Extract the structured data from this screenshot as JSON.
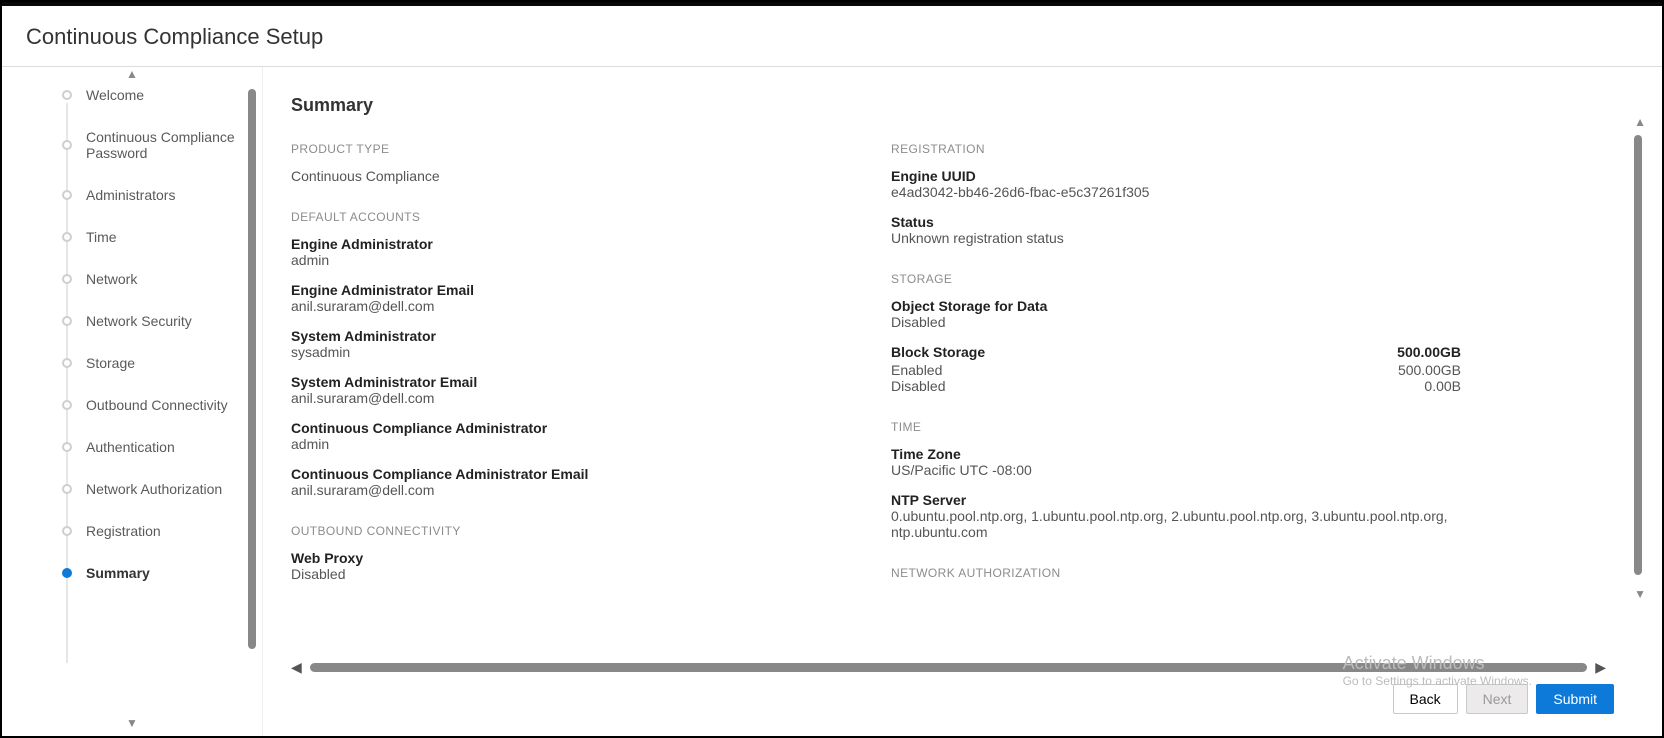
{
  "header": {
    "title": "Continuous Compliance Setup"
  },
  "sidebar": {
    "steps": [
      {
        "label": "Welcome"
      },
      {
        "label": "Continuous Compliance Password"
      },
      {
        "label": "Administrators"
      },
      {
        "label": "Time"
      },
      {
        "label": "Network"
      },
      {
        "label": "Network Security"
      },
      {
        "label": "Storage"
      },
      {
        "label": "Outbound Connectivity"
      },
      {
        "label": "Authentication"
      },
      {
        "label": "Network Authorization"
      },
      {
        "label": "Registration"
      },
      {
        "label": "Summary"
      }
    ],
    "active_index": 11
  },
  "main": {
    "title": "Summary",
    "left": {
      "product_type": {
        "heading": "PRODUCT TYPE",
        "value": "Continuous Compliance"
      },
      "default_accounts": {
        "heading": "DEFAULT ACCOUNTS",
        "engine_admin": {
          "label": "Engine Administrator",
          "value": "admin"
        },
        "engine_admin_email": {
          "label": "Engine Administrator Email",
          "value": "anil.suraram@dell.com"
        },
        "sys_admin": {
          "label": "System Administrator",
          "value": "sysadmin"
        },
        "sys_admin_email": {
          "label": "System Administrator Email",
          "value": "anil.suraram@dell.com"
        },
        "cc_admin": {
          "label": "Continuous Compliance Administrator",
          "value": "admin"
        },
        "cc_admin_email": {
          "label": "Continuous Compliance Administrator Email",
          "value": "anil.suraram@dell.com"
        }
      },
      "outbound": {
        "heading": "OUTBOUND CONNECTIVITY",
        "web_proxy": {
          "label": "Web Proxy",
          "value": "Disabled"
        }
      }
    },
    "right": {
      "registration": {
        "heading": "REGISTRATION",
        "uuid": {
          "label": "Engine UUID",
          "value": "e4ad3042-bb46-26d6-fbac-e5c37261f305"
        },
        "status": {
          "label": "Status",
          "value": "Unknown registration status"
        }
      },
      "storage": {
        "heading": "STORAGE",
        "object": {
          "label": "Object Storage for Data",
          "value": "Disabled"
        },
        "block": {
          "label": "Block Storage",
          "total": "500.00GB",
          "enabled": {
            "label": "Enabled",
            "value": "500.00GB"
          },
          "disabled": {
            "label": "Disabled",
            "value": "0.00B"
          }
        }
      },
      "time": {
        "heading": "TIME",
        "tz": {
          "label": "Time Zone",
          "value": "US/Pacific UTC -08:00"
        },
        "ntp": {
          "label": "NTP Server",
          "value": "0.ubuntu.pool.ntp.org, 1.ubuntu.pool.ntp.org, 2.ubuntu.pool.ntp.org, 3.ubuntu.pool.ntp.org, ntp.ubuntu.com"
        }
      },
      "net_auth": {
        "heading": "NETWORK AUTHORIZATION"
      }
    }
  },
  "footer": {
    "back": "Back",
    "next": "Next",
    "submit": "Submit"
  },
  "watermark": {
    "line1": "Activate Windows",
    "line2": "Go to Settings to activate Windows."
  }
}
